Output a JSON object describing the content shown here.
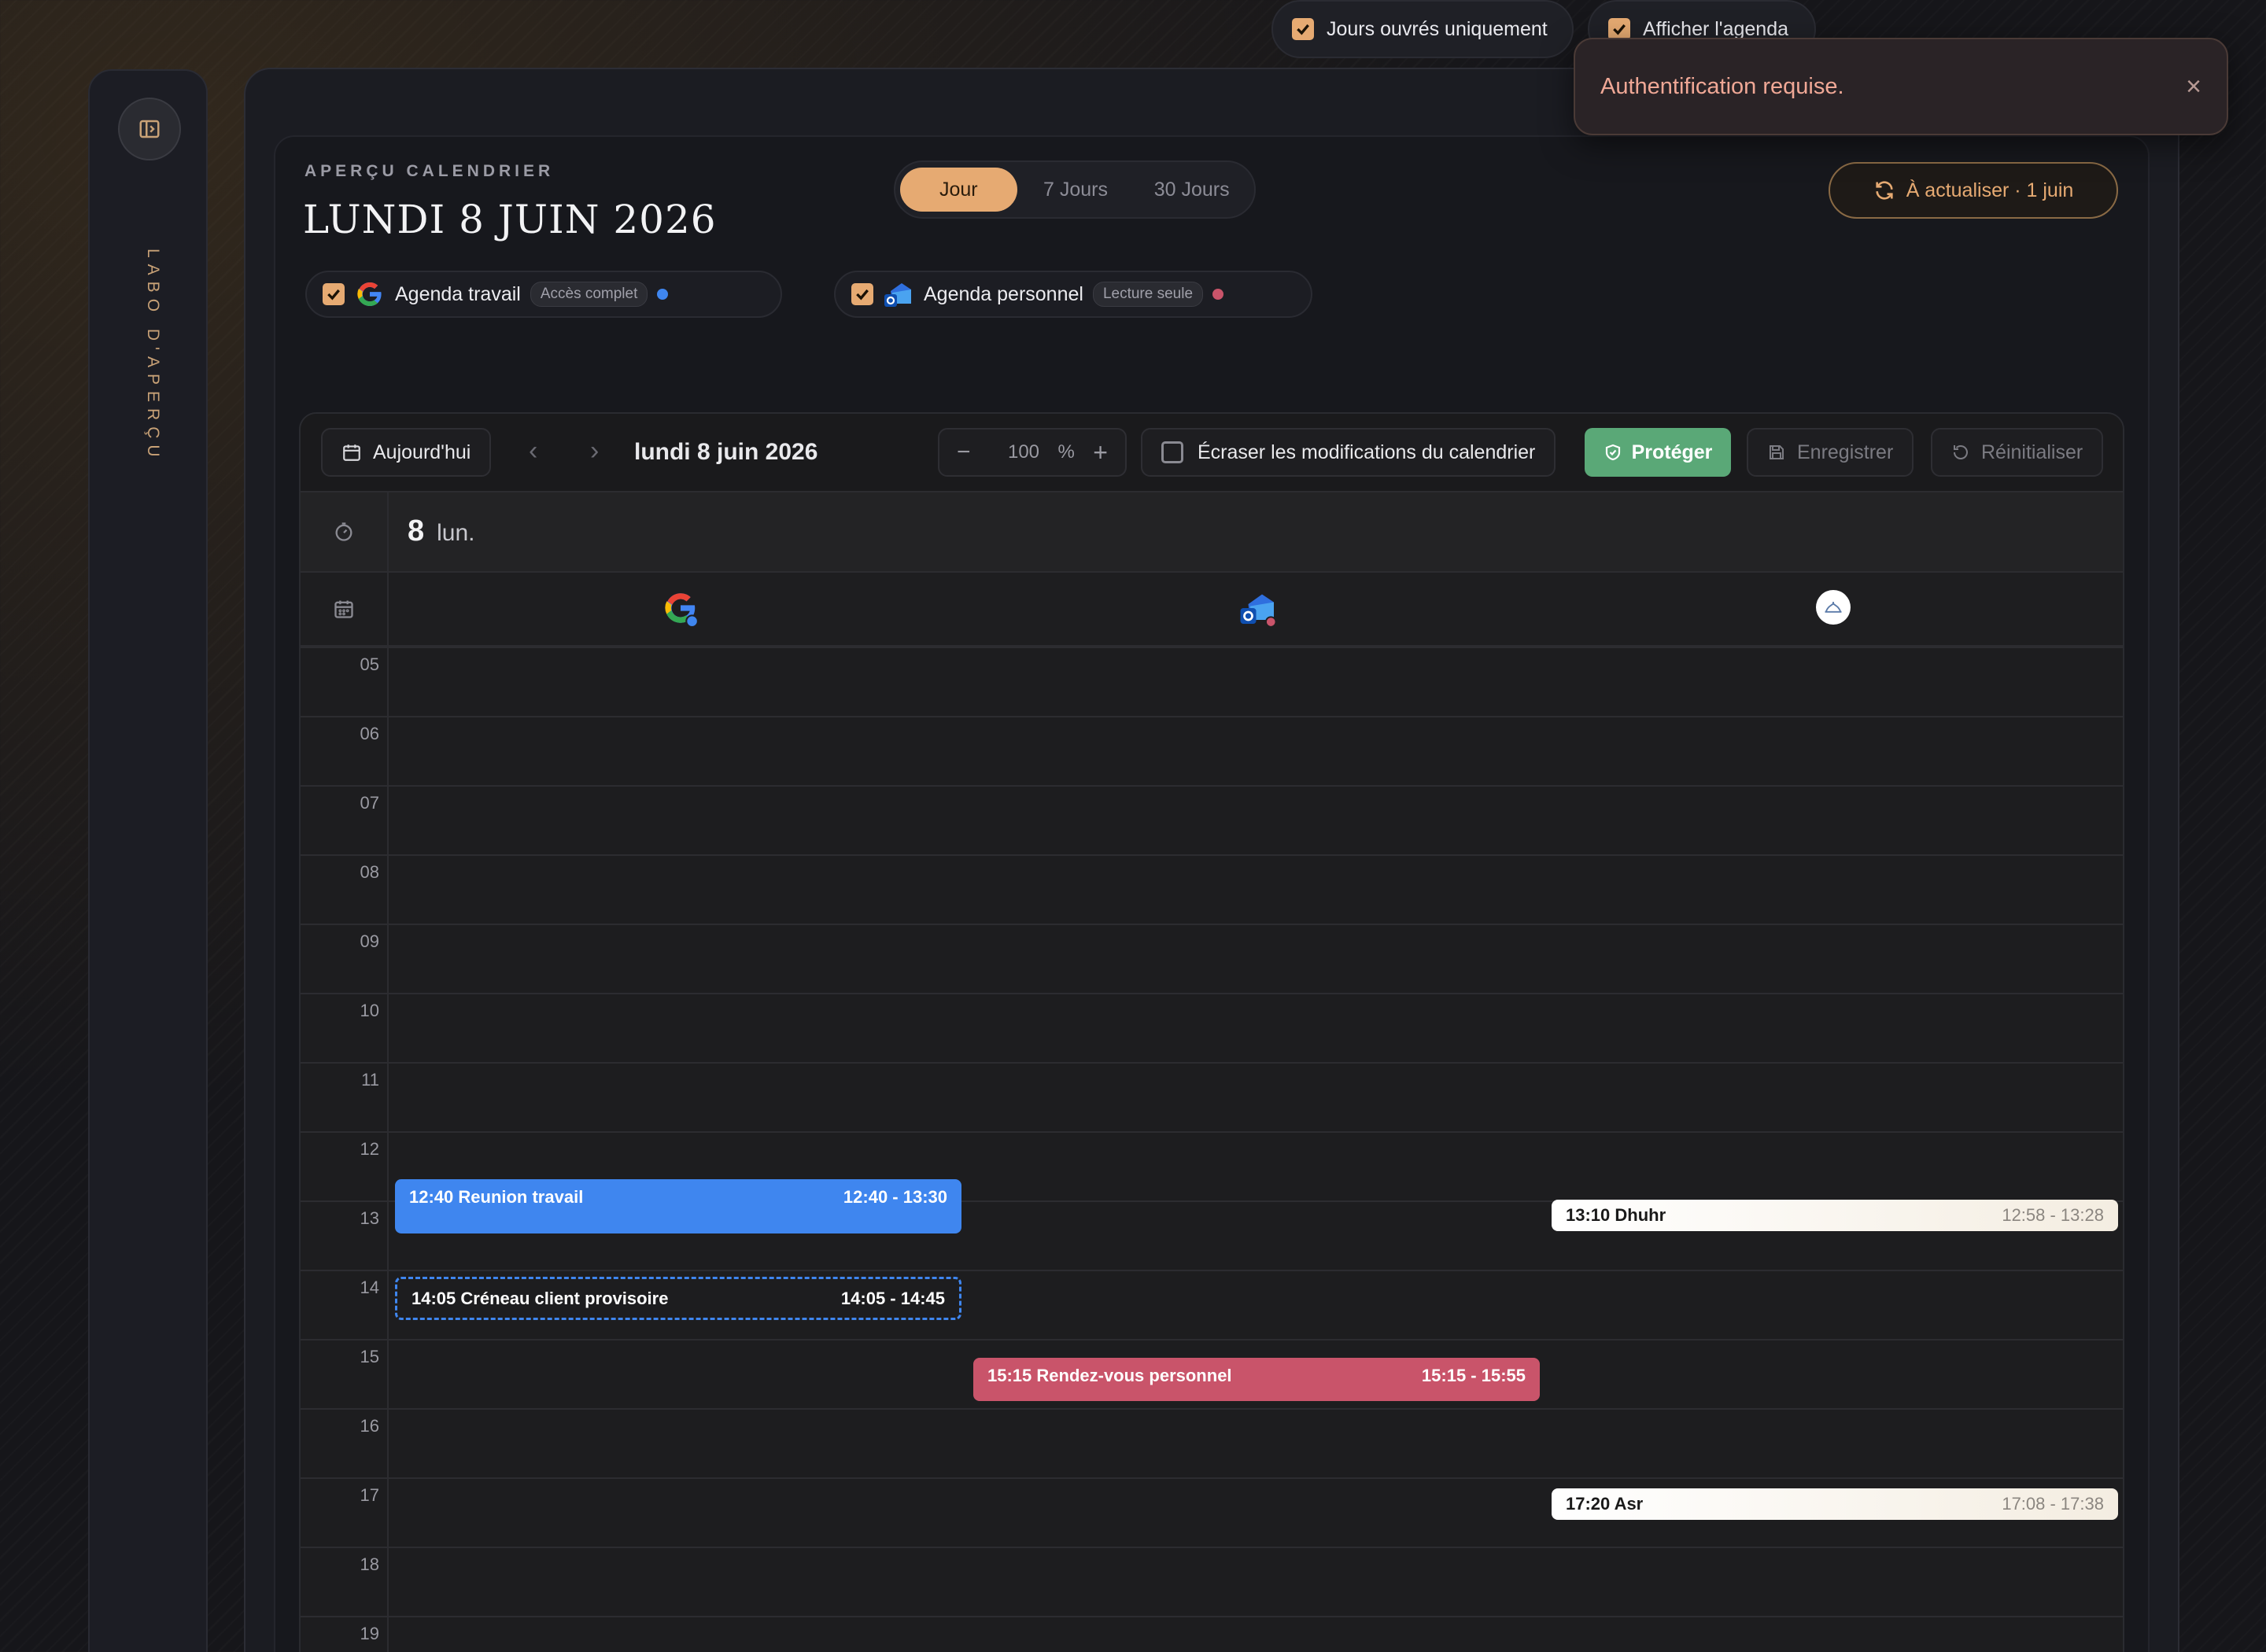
{
  "sidebar": {
    "label": "Labo d'aperçu"
  },
  "header": {
    "eyebrow": "APERÇU CALENDRIER",
    "title": "LUNDI 8 JUIN 2026",
    "views": [
      "Jour",
      "7 Jours",
      "30 Jours"
    ],
    "active_view": "Jour",
    "workdays_label": "Jours ouvrés uniquement",
    "show_agenda_label": "Afficher l'agenda",
    "refresh_label": "À actualiser · 1 juin",
    "accent": "#e6aa72"
  },
  "calendars": [
    {
      "name": "Agenda travail",
      "access": "Accès complet",
      "color": "#3f86ef",
      "icon": "google-icon"
    },
    {
      "name": "Agenda personnel",
      "access": "Lecture seule",
      "color": "#c9546a",
      "icon": "outlook-icon"
    }
  ],
  "toolbar": {
    "today_label": "Aujourd'hui",
    "date_label": "lundi 8 juin 2026",
    "zoom_value": "100",
    "zoom_unit": "%",
    "overwrite_label": "Écraser les modifications du calendrier",
    "protect_label": "Protéger",
    "save_label": "Enregistrer",
    "reset_label": "Réinitialiser"
  },
  "day": {
    "number": "8",
    "weekday": "lun."
  },
  "hours": [
    "05",
    "06",
    "07",
    "08",
    "09",
    "10",
    "11",
    "12",
    "13",
    "14",
    "15",
    "16",
    "17",
    "18",
    "19"
  ],
  "events": [
    {
      "title": "12:40 Reunion travail",
      "time": "12:40 - 13:30",
      "start": "12:40",
      "end": "13:30",
      "column": 0,
      "style": "blue"
    },
    {
      "title": "14:05 Créneau client provisoire",
      "time": "14:05 - 14:45",
      "start": "14:05",
      "end": "14:45",
      "column": 0,
      "style": "tentative"
    },
    {
      "title": "15:15 Rendez-vous personnel",
      "time": "15:15 - 15:55",
      "start": "15:15",
      "end": "15:55",
      "column": 1,
      "style": "red"
    },
    {
      "title": "13:10 Dhuhr",
      "time": "12:58 - 13:28",
      "start": "12:58",
      "end": "13:28",
      "column": 2,
      "style": "prayer"
    },
    {
      "title": "17:20 Asr",
      "time": "17:08 - 17:38",
      "start": "17:08",
      "end": "17:38",
      "column": 2,
      "style": "prayer"
    }
  ],
  "toast": {
    "message": "Authentification requise."
  }
}
